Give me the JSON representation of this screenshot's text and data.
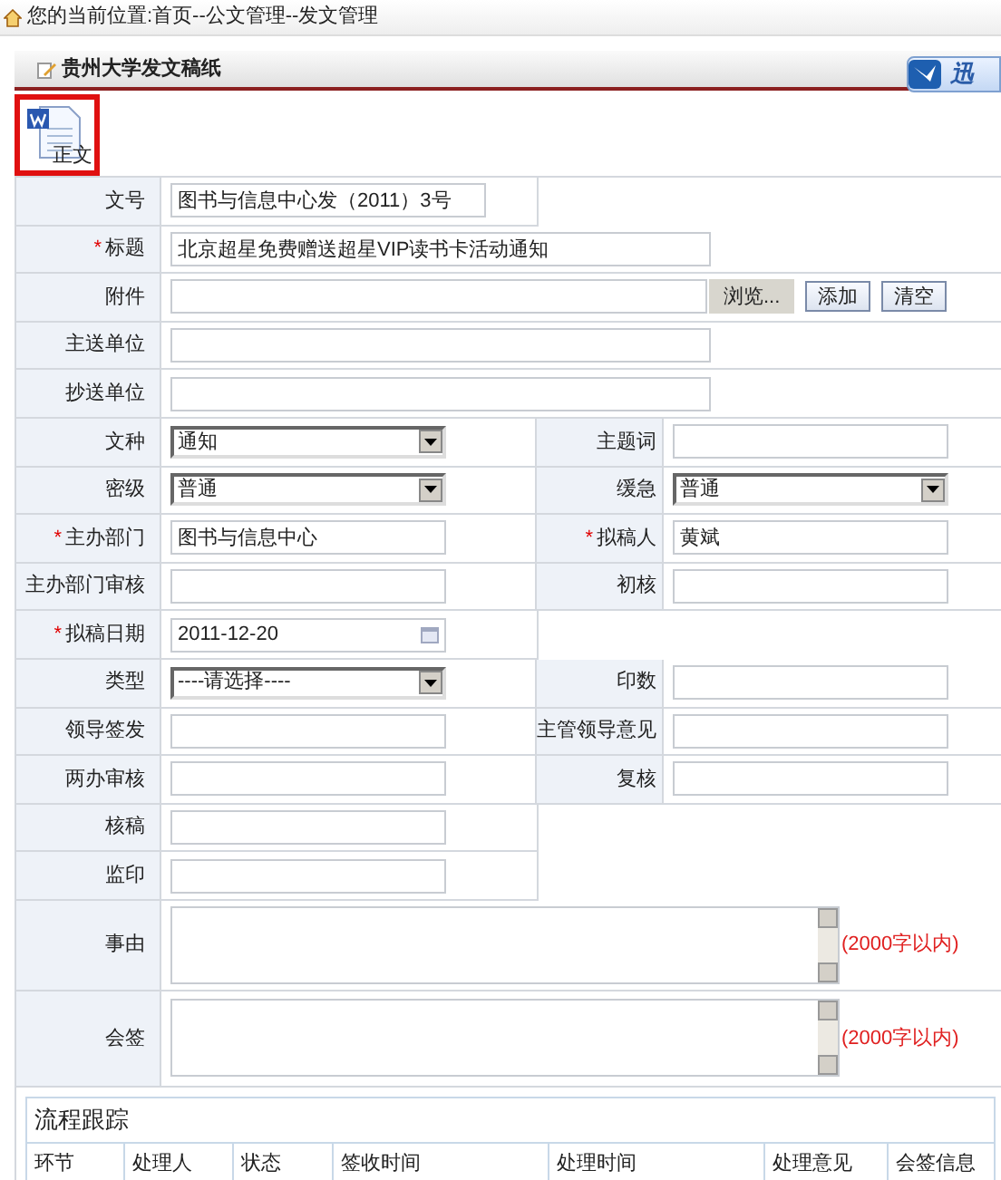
{
  "breadcrumb": "您的当前位置:首页--公文管理--发文管理",
  "panel_title": "贵州大学发文稿纸",
  "float_button": "迅",
  "doc_button": {
    "label": "正文",
    "selected": true
  },
  "rows": [
    {
      "kind": "half",
      "fields": [
        {
          "label": "文号",
          "kind": "text",
          "value": "图书与信息中心发（2011）3号"
        }
      ]
    },
    {
      "kind": "wide",
      "fields": [
        {
          "label": "标题",
          "mark": "*",
          "kind": "text",
          "value": "北京超星免费赠送超星VIP读书卡活动通知"
        }
      ]
    },
    {
      "kind": "wide",
      "fields": [
        {
          "label": "附件",
          "kind": "file",
          "buttons": [
            "浏览...",
            "添加",
            "清空"
          ]
        }
      ]
    },
    {
      "kind": "wide",
      "fields": [
        {
          "label": "主送单位",
          "kind": "text"
        }
      ]
    },
    {
      "kind": "wide",
      "fields": [
        {
          "label": "抄送单位",
          "kind": "text"
        }
      ]
    },
    {
      "kind": "pair",
      "fields": [
        {
          "label": "文种",
          "kind": "select",
          "value": "通知"
        },
        {
          "label": "主题词",
          "kind": "text"
        }
      ]
    },
    {
      "kind": "pair",
      "fields": [
        {
          "label": "密级",
          "kind": "select",
          "value": "普通"
        },
        {
          "label": "缓急",
          "kind": "select",
          "value": "普通"
        }
      ]
    },
    {
      "kind": "pair",
      "fields": [
        {
          "label": "主办部门",
          "mark": "*",
          "kind": "text",
          "value": "图书与信息中心"
        },
        {
          "label": "拟稿人",
          "mark": "*",
          "kind": "text",
          "value": "黄斌"
        }
      ]
    },
    {
      "kind": "pair",
      "fields": [
        {
          "label": "主办部门审核",
          "kind": "text"
        },
        {
          "label": "初核",
          "kind": "text"
        }
      ]
    },
    {
      "kind": "half",
      "fields": [
        {
          "label": "拟稿日期",
          "mark": "*",
          "kind": "date",
          "value": "2011-12-20"
        }
      ]
    },
    {
      "kind": "pair",
      "fields": [
        {
          "label": "类型",
          "kind": "select",
          "value": "----请选择----"
        },
        {
          "label": "印数",
          "kind": "text"
        }
      ]
    },
    {
      "kind": "pair",
      "fields": [
        {
          "label": "领导签发",
          "kind": "text"
        },
        {
          "label": "主管领导意见",
          "kind": "text"
        }
      ]
    },
    {
      "kind": "pair",
      "fields": [
        {
          "label": "两办审核",
          "kind": "text"
        },
        {
          "label": "复核",
          "kind": "text"
        }
      ]
    },
    {
      "kind": "half",
      "fields": [
        {
          "label": "核稿",
          "kind": "text"
        }
      ]
    },
    {
      "kind": "half",
      "fields": [
        {
          "label": "监印",
          "kind": "text"
        }
      ]
    },
    {
      "kind": "wide",
      "fields": [
        {
          "label": "事由",
          "kind": "textarea",
          "note": "(2000字以内)"
        }
      ]
    },
    {
      "kind": "wide",
      "fields": [
        {
          "label": "会签",
          "kind": "textarea",
          "note": "(2000字以内)"
        }
      ]
    }
  ],
  "tracking": {
    "title": "流程跟踪",
    "columns": [
      "环节",
      "处理人",
      "状态",
      "签收时间",
      "处理时间",
      "处理意见",
      "会签信息"
    ]
  }
}
